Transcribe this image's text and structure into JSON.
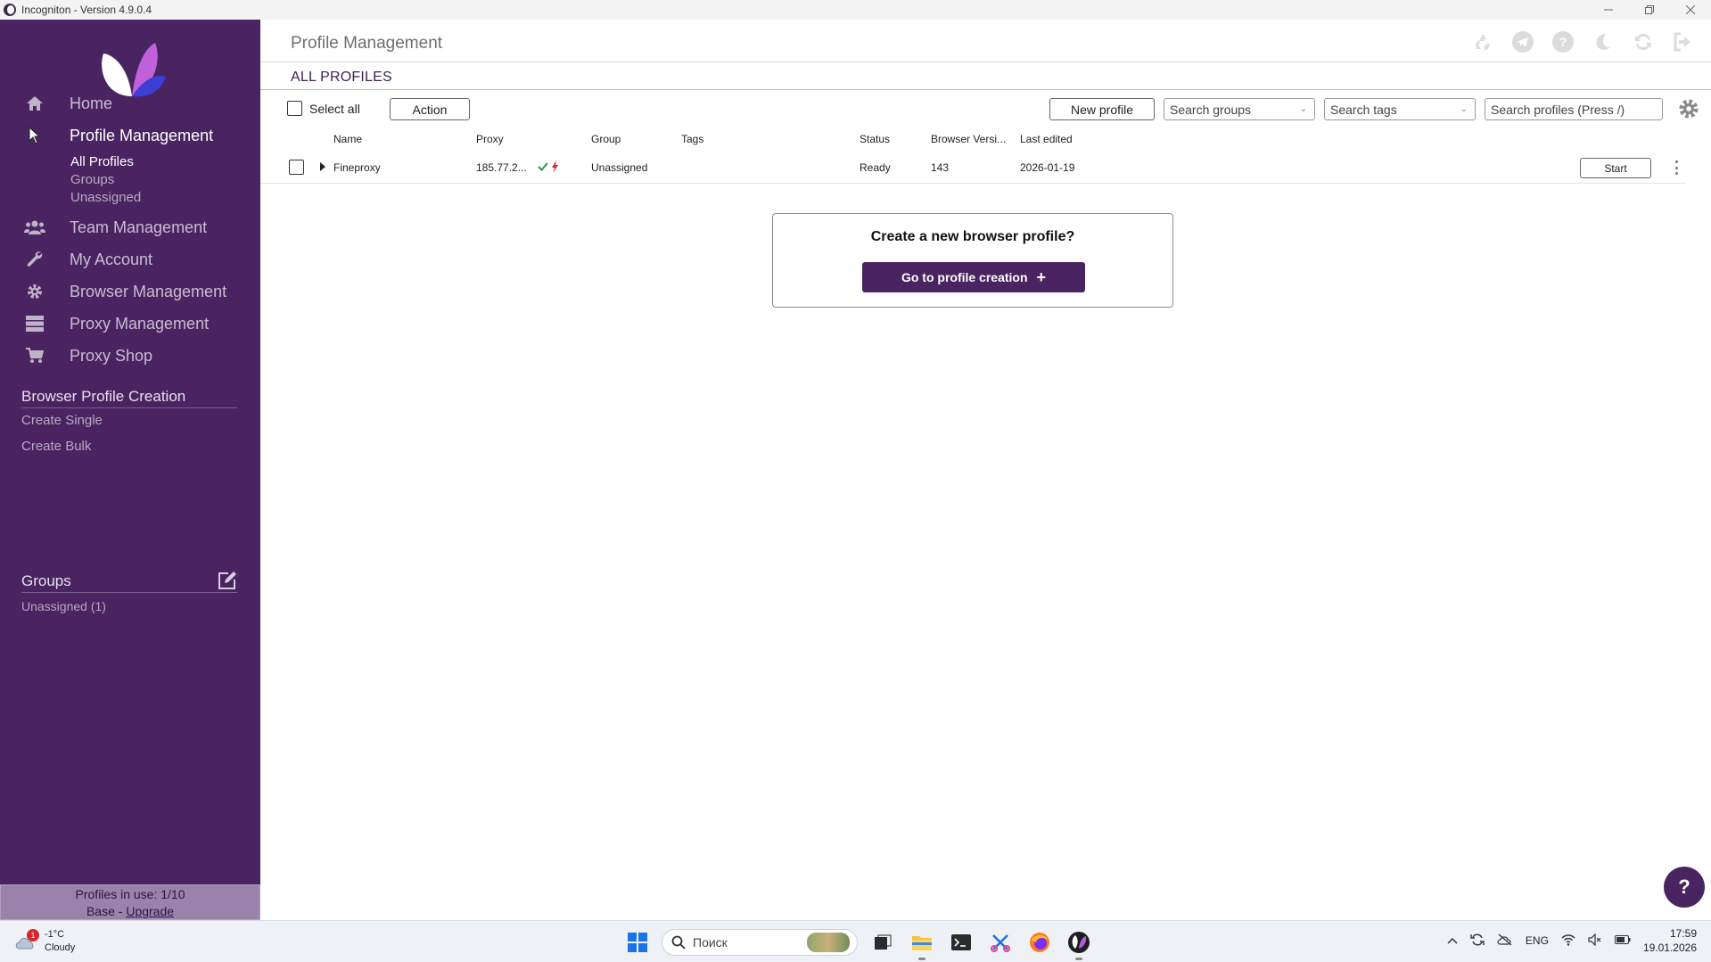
{
  "window": {
    "title": "Incogniton - Version 4.9.0.4"
  },
  "sidebar": {
    "nav": [
      {
        "label": "Home",
        "icon": "home-icon"
      },
      {
        "label": "Profile Management",
        "icon": "pointer-icon"
      },
      {
        "label": "Team Management",
        "icon": "users-icon"
      },
      {
        "label": "My Account",
        "icon": "wrench-icon"
      },
      {
        "label": "Browser Management",
        "icon": "gear-icon"
      },
      {
        "label": "Proxy Management",
        "icon": "server-icon"
      },
      {
        "label": "Proxy Shop",
        "icon": "cart-icon"
      }
    ],
    "profile_sub": [
      "All Profiles",
      "Groups",
      "Unassigned"
    ],
    "creation": {
      "title": "Browser Profile Creation",
      "links": [
        "Create Single",
        "Create Bulk"
      ]
    },
    "groups": {
      "title": "Groups",
      "items": [
        "Unassigned (1)"
      ]
    },
    "usage": {
      "line1": "Profiles in use:  1/10",
      "plan": "Base - ",
      "upgrade": "Upgrade"
    }
  },
  "main": {
    "title": "Profile Management",
    "section": "ALL PROFILES",
    "toolbar": {
      "select_all": "Select all",
      "action": "Action",
      "new_profile": "New profile",
      "search_groups": "Search groups",
      "search_tags": "Search tags",
      "search_profiles": "Search profiles (Press /)"
    },
    "columns": [
      "Name",
      "Proxy",
      "Group",
      "Tags",
      "Status",
      "Browser Versi...",
      "Last edited"
    ],
    "rows": [
      {
        "name": "Fineproxy",
        "proxy": "185.77.2...",
        "group": "Unassigned",
        "tags": "",
        "status": "Ready",
        "browser_version": "143",
        "last_edited": "2026-01-19",
        "start": "Start"
      }
    ],
    "create_card": {
      "question": "Create a new browser profile?",
      "button": "Go to profile creation"
    },
    "help": "?"
  },
  "taskbar": {
    "weather_temp": "-1°C",
    "weather_desc": "Cloudy",
    "weather_badge": "1",
    "search_placeholder": "Поиск",
    "lang": "ENG",
    "time": "17:59",
    "date": "19.01.2026"
  },
  "colors": {
    "sidebar": "#4a2461",
    "accent": "#4a2461",
    "proxy_ok": "#2e9a3a",
    "proxy_flash": "#d6262b"
  }
}
